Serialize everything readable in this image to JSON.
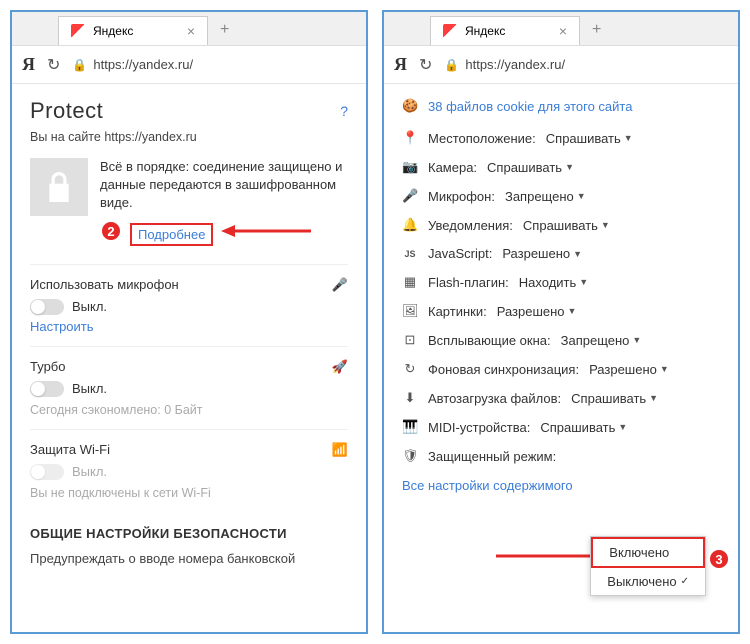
{
  "tab": {
    "title": "Яндекс"
  },
  "addr": {
    "url": "https://yandex.ru/"
  },
  "left": {
    "protect_title": "Protect",
    "help": "?",
    "site_label": "Вы на сайте https://yandex.ru",
    "conn_text": "Всё в порядке: соединение защищено и данные передаются в зашифрованном виде.",
    "more": "Подробнее",
    "badge2": "2",
    "mic": {
      "title": "Использовать микрофон",
      "state": "Выкл.",
      "configure": "Настроить"
    },
    "turbo": {
      "title": "Турбо",
      "state": "Выкл.",
      "saved": "Сегодня сэкономлено: 0 Байт"
    },
    "wifi": {
      "title": "Защита Wi-Fi",
      "state": "Выкл.",
      "warn": "Вы не подключены к сети Wi-Fi"
    },
    "sec_heading": "ОБЩИЕ НАСТРОЙКИ БЕЗОПАСНОСТИ",
    "bank_warn": "Предупреждать о вводе номера банковской"
  },
  "right": {
    "cookies": "38 файлов cookie для этого сайта",
    "perms": [
      {
        "icon": "📍",
        "label": "Местоположение:",
        "val": "Спрашивать"
      },
      {
        "icon": "📷",
        "label": "Камера:",
        "val": "Спрашивать"
      },
      {
        "icon": "🎤",
        "label": "Микрофон:",
        "val": "Запрещено"
      },
      {
        "icon": "🔔",
        "label": "Уведомления:",
        "val": "Спрашивать"
      },
      {
        "icon": "JS",
        "label": "JavaScript:",
        "val": "Разрешено"
      },
      {
        "icon": "▦",
        "label": "Flash-плагин:",
        "val": "Находить"
      },
      {
        "icon": "🖼",
        "label": "Картинки:",
        "val": "Разрешено"
      },
      {
        "icon": "⊡",
        "label": "Всплывающие окна:",
        "val": "Запрещено"
      },
      {
        "icon": "↻",
        "label": "Фоновая синхронизация:",
        "val": "Разрешено"
      },
      {
        "icon": "⬇",
        "label": "Автозагрузка файлов:",
        "val": "Спрашивать"
      },
      {
        "icon": "🎹",
        "label": "MIDI-устройства:",
        "val": "Спрашивать"
      },
      {
        "icon": "🛡",
        "label": "Защищенный режим:",
        "val": ""
      }
    ],
    "dropdown": {
      "on": "Включено",
      "off": "Выключено"
    },
    "badge3": "3",
    "all": "Все настройки содержимого"
  }
}
